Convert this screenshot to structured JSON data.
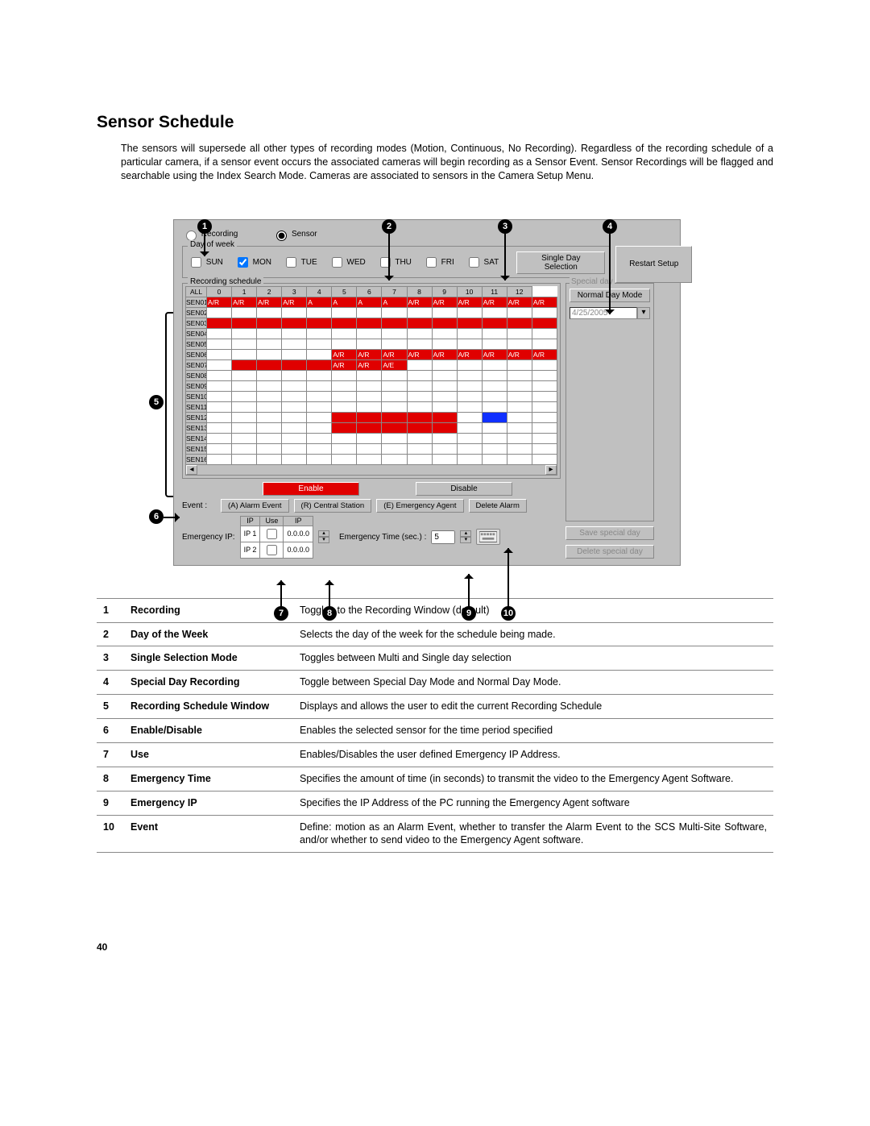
{
  "heading": "Sensor Schedule",
  "intro": "The sensors will supersede all other types of recording modes (Motion, Continuous, No Recording).  Regardless of the recording schedule of a particular camera, if a sensor event occurs the associated cameras will begin recording as a Sensor Event.  Sensor Recordings will be flagged and searchable using the Index Search Mode.  Cameras are associated to sensors in the Camera Setup Menu.",
  "page_number": "40",
  "ui": {
    "radios": {
      "recording": "Recording",
      "sensor": "Sensor"
    },
    "day_group": "Day of week",
    "days": [
      "SUN",
      "MON",
      "TUE",
      "WED",
      "THU",
      "FRI",
      "SAT"
    ],
    "day_checked_index": 1,
    "single_day_btn": "Single Day Selection",
    "restart_btn": "Restart Setup",
    "rec_sched": "Recording schedule",
    "hours_header_first": "ALL",
    "hours": [
      "0",
      "1",
      "2",
      "3",
      "4",
      "5",
      "6",
      "7",
      "8",
      "9",
      "10",
      "11",
      "12"
    ],
    "rows": [
      {
        "label": "SEN01",
        "cells": [
          "A/R",
          "A/R",
          "A/R",
          "A/R",
          "A",
          "A",
          "A",
          "A",
          "A/R",
          "A/R",
          "A/R",
          "A/R",
          "A/R",
          "A/R"
        ],
        "cls": [
          "red",
          "red",
          "red",
          "red",
          "red",
          "red",
          "red",
          "red",
          "red",
          "red",
          "red",
          "red",
          "red",
          "red"
        ]
      },
      {
        "label": "SEN02",
        "cells": [
          "",
          "",
          "",
          "",
          "",
          "",
          "",
          "",
          "",
          "",
          "",
          "",
          "",
          ""
        ],
        "cls": [
          "",
          "",
          "",
          "",
          "",
          "",
          "",
          "",
          "",
          "",
          "",
          "",
          "",
          ""
        ]
      },
      {
        "label": "SEN03",
        "cells": [
          "",
          "",
          "",
          "",
          "",
          "",
          "",
          "",
          "",
          "",
          "",
          "",
          "",
          ""
        ],
        "cls": [
          "red",
          "red",
          "red",
          "red",
          "red",
          "red",
          "red",
          "red",
          "red",
          "red",
          "red",
          "red",
          "red",
          "red"
        ]
      },
      {
        "label": "SEN04",
        "cells": [
          "",
          "",
          "",
          "",
          "",
          "",
          "",
          "",
          "",
          "",
          "",
          "",
          "",
          ""
        ],
        "cls": [
          "",
          "",
          "",
          "",
          "",
          "",
          "",
          "",
          "",
          "",
          "",
          "",
          "",
          ""
        ]
      },
      {
        "label": "SEN05",
        "cells": [
          "",
          "",
          "",
          "",
          "",
          "",
          "",
          "",
          "",
          "",
          "",
          "",
          "",
          ""
        ],
        "cls": [
          "",
          "",
          "",
          "",
          "",
          "",
          "",
          "",
          "",
          "",
          "",
          "",
          "",
          ""
        ]
      },
      {
        "label": "SEN06",
        "cells": [
          "",
          "",
          "",
          "",
          "",
          "A/R",
          "A/R",
          "A/R",
          "A/R",
          "A/R",
          "A/R",
          "A/R",
          "A/R",
          "A/R"
        ],
        "cls": [
          "",
          "",
          "",
          "",
          "",
          "red",
          "red",
          "red",
          "red",
          "red",
          "red",
          "red",
          "red",
          "red"
        ]
      },
      {
        "label": "SEN07",
        "cells": [
          "",
          "",
          "",
          "",
          "",
          "A/R",
          "A/R",
          "A/E",
          "",
          "",
          "",
          "",
          "",
          ""
        ],
        "cls": [
          "",
          "red",
          "red",
          "red",
          "red",
          "red",
          "red",
          "red",
          "",
          "",
          "",
          "",
          "",
          ""
        ]
      },
      {
        "label": "SEN08",
        "cells": [
          "",
          "",
          "",
          "",
          "",
          "",
          "",
          "",
          "",
          "",
          "",
          "",
          "",
          ""
        ],
        "cls": [
          "",
          "",
          "",
          "",
          "",
          "",
          "",
          "",
          "",
          "",
          "",
          "",
          "",
          ""
        ]
      },
      {
        "label": "SEN09",
        "cells": [
          "",
          "",
          "",
          "",
          "",
          "",
          "",
          "",
          "",
          "",
          "",
          "",
          "",
          ""
        ],
        "cls": [
          "",
          "",
          "",
          "",
          "",
          "",
          "",
          "",
          "",
          "",
          "",
          "",
          "",
          ""
        ]
      },
      {
        "label": "SEN10",
        "cells": [
          "",
          "",
          "",
          "",
          "",
          "",
          "",
          "",
          "",
          "",
          "",
          "",
          "",
          ""
        ],
        "cls": [
          "",
          "",
          "",
          "",
          "",
          "",
          "",
          "",
          "",
          "",
          "",
          "",
          "",
          ""
        ]
      },
      {
        "label": "SEN11",
        "cells": [
          "",
          "",
          "",
          "",
          "",
          "",
          "",
          "",
          "",
          "",
          "",
          "",
          "",
          ""
        ],
        "cls": [
          "",
          "",
          "",
          "",
          "",
          "",
          "",
          "",
          "",
          "",
          "",
          "",
          "",
          ""
        ]
      },
      {
        "label": "SEN12",
        "cells": [
          "",
          "",
          "",
          "",
          "",
          "",
          "",
          "",
          "",
          "",
          "",
          "",
          "",
          ""
        ],
        "cls": [
          "",
          "",
          "",
          "",
          "",
          "red",
          "red",
          "red",
          "red",
          "red",
          "",
          "blue",
          "",
          ""
        ]
      },
      {
        "label": "SEN13",
        "cells": [
          "",
          "",
          "",
          "",
          "",
          "",
          "",
          "",
          "",
          "",
          "",
          "",
          "",
          ""
        ],
        "cls": [
          "",
          "",
          "",
          "",
          "",
          "red",
          "red",
          "red",
          "red",
          "red",
          "",
          "",
          "",
          ""
        ]
      },
      {
        "label": "SEN14",
        "cells": [
          "",
          "",
          "",
          "",
          "",
          "",
          "",
          "",
          "",
          "",
          "",
          "",
          "",
          ""
        ],
        "cls": [
          "",
          "",
          "",
          "",
          "",
          "",
          "",
          "",
          "",
          "",
          "",
          "",
          "",
          ""
        ]
      },
      {
        "label": "SEN15",
        "cells": [
          "",
          "",
          "",
          "",
          "",
          "",
          "",
          "",
          "",
          "",
          "",
          "",
          "",
          ""
        ],
        "cls": [
          "",
          "",
          "",
          "",
          "",
          "",
          "",
          "",
          "",
          "",
          "",
          "",
          "",
          ""
        ]
      },
      {
        "label": "SEN16",
        "cells": [
          "",
          "",
          "",
          "",
          "",
          "",
          "",
          "",
          "",
          "",
          "",
          "",
          "",
          ""
        ],
        "cls": [
          "",
          "",
          "",
          "",
          "",
          "",
          "",
          "",
          "",
          "",
          "",
          "",
          "",
          ""
        ]
      }
    ],
    "enable_btn": "Enable",
    "disable_btn": "Disable",
    "event_label": "Event :",
    "event_buttons": {
      "a": "(A) Alarm Event",
      "r": "(R) Central Station",
      "e": "(E) Emergency Agent",
      "del": "Delete Alarm"
    },
    "eip_label": "Emergency IP:",
    "eip_cols": [
      "IP",
      "Use",
      "IP"
    ],
    "eip_rows": [
      {
        "name": "IP 1",
        "use": false,
        "ip": "0.0.0.0"
      },
      {
        "name": "IP 2",
        "use": false,
        "ip": "0.0.0.0"
      }
    ],
    "et_label": "Emergency Time (sec.) :",
    "et_value": "5",
    "special_legend": "Special day",
    "normal_day_btn": "Normal Day Mode",
    "special_date": "4/25/2005",
    "save_special_btn": "Save special day",
    "delete_special_btn": "Delete special day"
  },
  "legend": [
    {
      "n": "1",
      "name": "Recording",
      "desc": "Toggles to the Recording Window (default)"
    },
    {
      "n": "2",
      "name": "Day of the Week",
      "desc": "Selects the day of the week for the schedule being made."
    },
    {
      "n": "3",
      "name": "Single Selection Mode",
      "desc": "Toggles between Multi and Single day selection"
    },
    {
      "n": "4",
      "name": "Special Day Recording",
      "desc": "Toggle between Special Day Mode and Normal Day Mode."
    },
    {
      "n": "5",
      "name": "Recording Schedule Window",
      "desc": "Displays and allows the user to edit the current Recording Schedule"
    },
    {
      "n": "6",
      "name": "Enable/Disable",
      "desc": "Enables the selected sensor for the time period specified"
    },
    {
      "n": "7",
      "name": "Use",
      "desc": "Enables/Disables the user defined Emergency IP Address."
    },
    {
      "n": "8",
      "name": "Emergency Time",
      "desc": "Specifies the amount of time (in seconds) to transmit the video to the Emergency Agent Software."
    },
    {
      "n": "9",
      "name": "Emergency IP",
      "desc": "Specifies the IP Address of the PC running the Emergency Agent software"
    },
    {
      "n": "10",
      "name": "Event",
      "desc": "Define: motion as an Alarm Event, whether to transfer the Alarm Event to the SCS Multi-Site Software, and/or whether to send video to the Emergency Agent software."
    }
  ]
}
